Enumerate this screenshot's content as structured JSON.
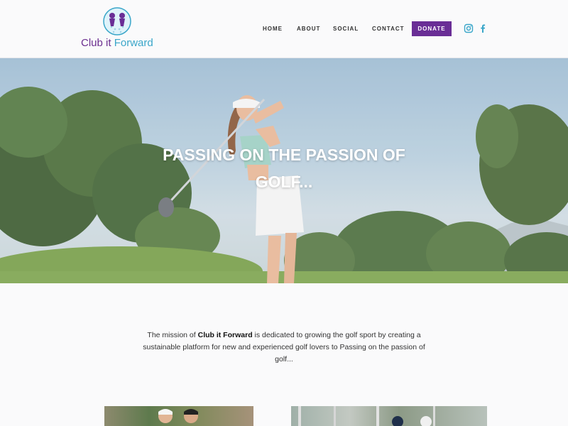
{
  "brand": {
    "name_part1": "Club it",
    "name_part2": "Forward"
  },
  "nav": {
    "home": "HOME",
    "about": "ABOUT",
    "social": "SOCIAL",
    "contact": "CONTACT",
    "donate": "DONATE"
  },
  "social_icons": [
    "instagram-icon",
    "facebook-icon"
  ],
  "hero": {
    "title": "PASSING ON THE PASSION OF GOLF..."
  },
  "mission": {
    "prefix": "The mission of ",
    "brand": "Club it Forward",
    "suffix": " is dedicated to growing the golf sport by creating a sustainable platform for new and experienced golf lovers to Passing on the passion of golf..."
  },
  "colors": {
    "brand_purple": "#6a2e96",
    "brand_blue": "#3aa6c9",
    "background": "#fafafb"
  }
}
